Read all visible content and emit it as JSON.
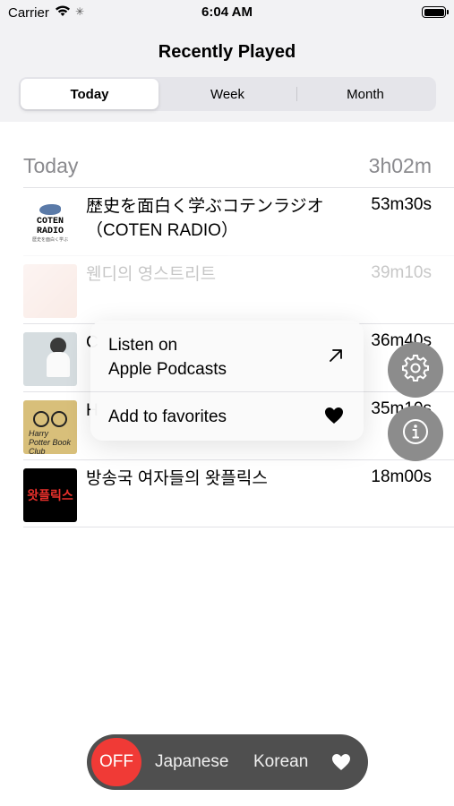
{
  "status_bar": {
    "carrier": "Carrier",
    "time": "6:04 AM"
  },
  "nav": {
    "title": "Recently Played"
  },
  "segments": [
    {
      "label": "Today",
      "selected": true
    },
    {
      "label": "Week",
      "selected": false
    },
    {
      "label": "Month",
      "selected": false
    }
  ],
  "section": {
    "title": "Today",
    "total": "3h02m"
  },
  "rows": [
    {
      "title": "歴史を面白く学ぶコテンラジオ（COTEN RADIO）",
      "duration": "53m30s",
      "art_text": "COTEN RADIO",
      "art_sub": "歴史を面白く学ぶ"
    },
    {
      "title": "웬디의 영스트리트",
      "duration": "39m10s"
    },
    {
      "title": "C",
      "duration": "36m40s"
    },
    {
      "title": "H",
      "duration": "35m10s",
      "art_text": "Harry Potter Book Club"
    },
    {
      "title": "방송국 여자들의 왓플릭스",
      "duration": "18m00s",
      "art_text": "왓플릭스"
    }
  ],
  "context_menu": {
    "items": [
      {
        "label_line1": "Listen on",
        "label_line2": "Apple Podcasts",
        "icon": "arrow-up-right-icon"
      },
      {
        "label": "Add to favorites",
        "icon": "heart-icon"
      }
    ]
  },
  "fabs": [
    {
      "icon": "gear-icon"
    },
    {
      "icon": "info-icon"
    }
  ],
  "bottom_bar": {
    "off_label": "OFF",
    "lang1": "Japanese",
    "lang2": "Korean",
    "favorite_icon": "heart-icon"
  },
  "colors": {
    "accent_red": "#f03a36",
    "bar_bg": "#4f4f4f",
    "fab_bg": "#8c8c8c"
  }
}
